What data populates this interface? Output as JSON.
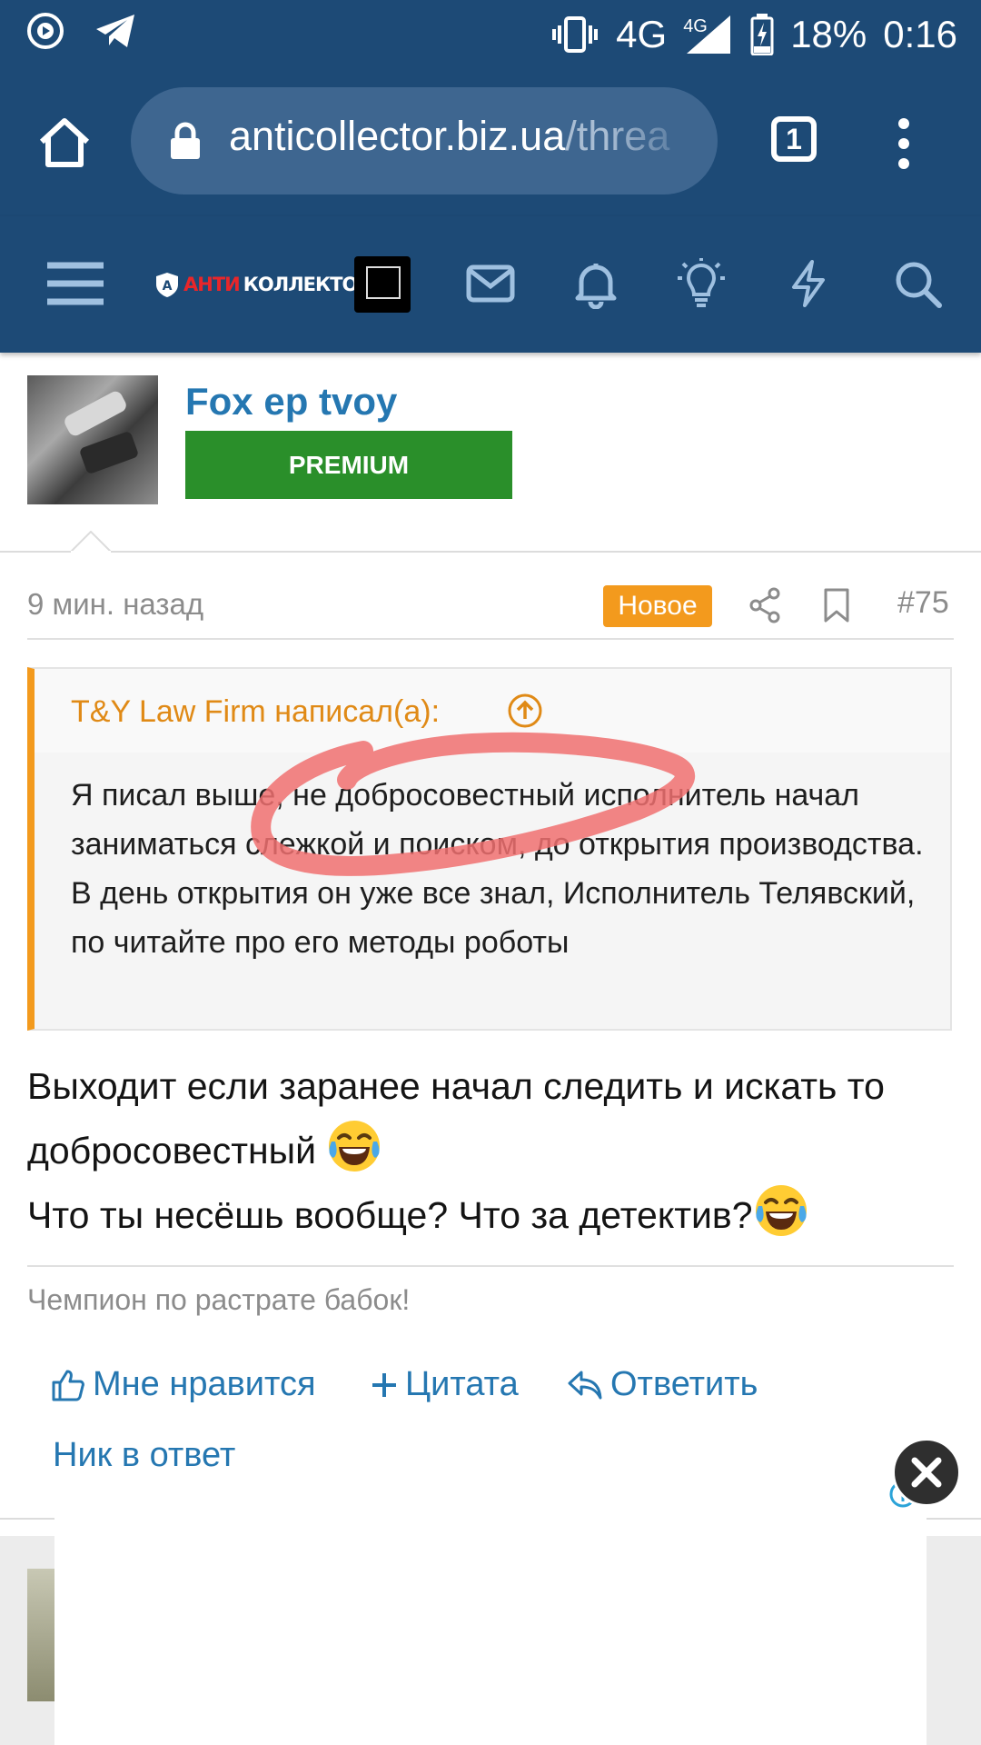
{
  "status_bar": {
    "network": "4G",
    "network_small": "4G",
    "battery": "18%",
    "time": "0:16"
  },
  "browser": {
    "url_domain": "anticollector.biz.ua",
    "url_path": "/threa",
    "tab_count": "1"
  },
  "site_nav": {
    "logo_red": "АНТИ",
    "logo_white": "КОЛЛЕКТОР",
    "icons": [
      "menu-icon",
      "mail-icon",
      "bell-icon",
      "lightbulb-icon",
      "lightning-icon",
      "search-icon"
    ]
  },
  "post": {
    "username": "Fox ep tvoy",
    "rank_badge": "PREMIUM",
    "time": "9 мин. назад",
    "new_badge": "Новое",
    "number": "#75",
    "quote": {
      "author": "T&Y Law Firm написал(а):",
      "text": "Я писал выше, не добросовестный исполнитель начал заниматься слежкой и поиском, до открытия производства. В день открытия он уже все знал, Исполнитель Телявский, по читайте про его методы роботы"
    },
    "message": {
      "line1": "Выходит если заранее начал следить и искать то добросовестный",
      "line2": "Что ты несёшь вообще? Что за детектив?"
    },
    "signature": "Чемпион по растрате бабок!",
    "actions": {
      "like": "Мне нравится",
      "quote": "Цитата",
      "reply": "Ответить",
      "nick_reply": "Ник в ответ"
    }
  },
  "colors": {
    "header": "#1d4a76",
    "link": "#2577b1",
    "accent_orange": "#f39a1d",
    "premium_green": "#2a8f2a"
  }
}
